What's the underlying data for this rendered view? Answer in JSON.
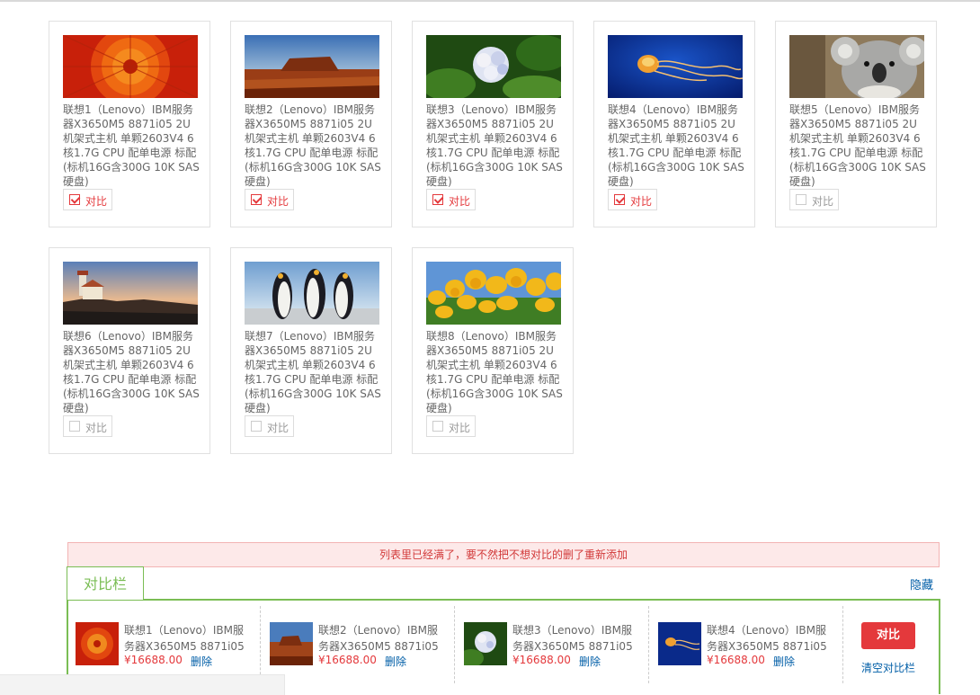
{
  "products": [
    {
      "title": "联想1（Lenovo）IBM服务器X3650M5 8871i05 2U机架式主机 单颗2603V4 6核1.7G CPU 配单电源 标配(标机16G含300G 10K SAS硬盘)",
      "compare_label": "对比",
      "checked": true,
      "image": "red-flower"
    },
    {
      "title": "联想2（Lenovo）IBM服务器X3650M5 8871i05 2U机架式主机 单颗2603V4 6核1.7G CPU 配单电源 标配(标机16G含300G 10K SAS硬盘)",
      "compare_label": "对比",
      "checked": true,
      "image": "desert"
    },
    {
      "title": "联想3（Lenovo）IBM服务器X3650M5 8871i05 2U机架式主机 单颗2603V4 6核1.7G CPU 配单电源 标配(标机16G含300G 10K SAS硬盘)",
      "compare_label": "对比",
      "checked": true,
      "image": "hydrangea"
    },
    {
      "title": "联想4（Lenovo）IBM服务器X3650M5 8871i05 2U机架式主机 单颗2603V4 6核1.7G CPU 配单电源 标配(标机16G含300G 10K SAS硬盘)",
      "compare_label": "对比",
      "checked": true,
      "image": "jellyfish"
    },
    {
      "title": "联想5（Lenovo）IBM服务器X3650M5 8871i05 2U机架式主机 单颗2603V4 6核1.7G CPU 配单电源 标配(标机16G含300G 10K SAS硬盘)",
      "compare_label": "对比",
      "checked": false,
      "image": "koala"
    },
    {
      "title": "联想6（Lenovo）IBM服务器X3650M5 8871i05 2U机架式主机 单颗2603V4 6核1.7G CPU 配单电源 标配(标机16G含300G 10K SAS硬盘)",
      "compare_label": "对比",
      "checked": false,
      "image": "lighthouse"
    },
    {
      "title": "联想7（Lenovo）IBM服务器X3650M5 8871i05 2U机架式主机 单颗2603V4 6核1.7G CPU 配单电源 标配(标机16G含300G 10K SAS硬盘)",
      "compare_label": "对比",
      "checked": false,
      "image": "penguins"
    },
    {
      "title": "联想8（Lenovo）IBM服务器X3650M5 8871i05 2U机架式主机 单颗2603V4 6核1.7G CPU 配单电源 标配(标机16G含300G 10K SAS硬盘)",
      "compare_label": "对比",
      "checked": false,
      "image": "tulips"
    }
  ],
  "compare_bar": {
    "notice": "列表里已经满了，要不然把不想对比的删了重新添加",
    "tab_label": "对比栏",
    "hide_label": "隐藏",
    "items": [
      {
        "name": "联想1（Lenovo）IBM服务器X3650M5 8871i05",
        "price": "¥16688.00",
        "delete_label": "删除",
        "image": "red-flower"
      },
      {
        "name": "联想2（Lenovo）IBM服务器X3650M5 8871i05",
        "price": "¥16688.00",
        "delete_label": "删除",
        "image": "desert"
      },
      {
        "name": "联想3（Lenovo）IBM服务器X3650M5 8871i05",
        "price": "¥16688.00",
        "delete_label": "删除",
        "image": "hydrangea"
      },
      {
        "name": "联想4（Lenovo）IBM服务器X3650M5 8871i05",
        "price": "¥16688.00",
        "delete_label": "删除",
        "image": "jellyfish"
      }
    ],
    "compare_button": "对比",
    "clear_label": "清空对比栏"
  },
  "colors": {
    "accent_red": "#e4393c",
    "link_blue": "#005ea7",
    "tab_green": "#7abd54"
  }
}
